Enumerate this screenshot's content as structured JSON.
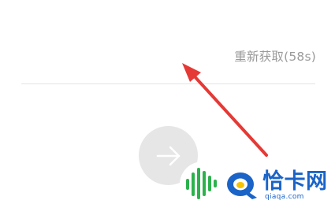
{
  "verification": {
    "resend_label": "重新获取(58s)"
  },
  "next_button": {
    "icon": "arrow-right-icon"
  },
  "annotation": {
    "type": "red-arrow",
    "color": "#e53935"
  },
  "watermark": {
    "brand": "恰卡网",
    "domain": "qiaqa.com",
    "brand_color": "#1a64c8",
    "accent_color": "#2bb24c"
  }
}
